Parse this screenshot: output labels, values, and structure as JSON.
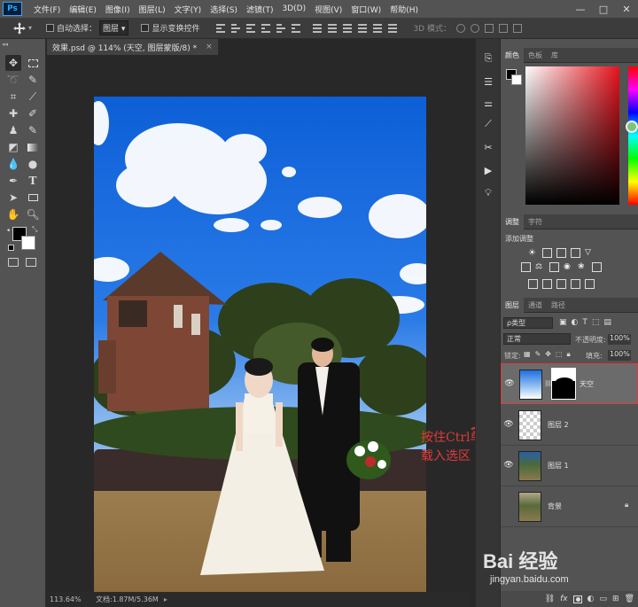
{
  "menubar": {
    "logo": "Ps",
    "items": [
      "文件(F)",
      "编辑(E)",
      "图像(I)",
      "图层(L)",
      "文字(Y)",
      "选择(S)",
      "滤镜(T)",
      "3D(D)",
      "视图(V)",
      "窗口(W)",
      "帮助(H)"
    ],
    "window_controls": [
      "—",
      "□",
      "✕"
    ]
  },
  "options": {
    "auto_select_label": "自动选择：",
    "auto_select_value": "图层",
    "show_transform_label": "显示变换控件",
    "mode_3d_label": "3D 模式："
  },
  "document": {
    "tab_title": "效果.psd @ 114% (天空, 图层蒙版/8) *",
    "tab_close": "×",
    "zoom": "113.64%",
    "doc_size": "文档:1.87M/5.36M"
  },
  "annotation": {
    "line1": "按住Ctrl单击",
    "line2": "载入选区"
  },
  "color_panel": {
    "tabs": [
      "颜色",
      "色板",
      "库"
    ],
    "foreground": "#000000",
    "background": "#ffffff"
  },
  "adjust_panel": {
    "tabs": [
      "调整",
      "字符"
    ],
    "title": "添加调整"
  },
  "layers_panel": {
    "tabs": [
      "图层",
      "通道",
      "路径"
    ],
    "filter_label": "ρ类型",
    "blend_mode": "正常",
    "opacity_label": "不透明度:",
    "opacity_value": "100%",
    "lock_label": "锁定:",
    "fill_label": "填充:",
    "fill_value": "100%",
    "layers": [
      {
        "name": "天空",
        "visible": true,
        "selected": true
      },
      {
        "name": "图层 2",
        "visible": true,
        "selected": false
      },
      {
        "name": "图层 1",
        "visible": true,
        "selected": false
      },
      {
        "name": "背景",
        "visible": false,
        "selected": false
      }
    ],
    "footer_icons": [
      "link-icon",
      "fx-icon",
      "add-mask-icon",
      "adjustment-icon",
      "folder-icon",
      "new-layer-icon",
      "trash-icon"
    ]
  },
  "watermark": {
    "brand": "Bai 经验",
    "url": "jingyan.baidu.com"
  },
  "colors": {
    "accent_red": "#e23a3a",
    "panel_bg": "#535353",
    "selected_layer": "#6b6b6b"
  }
}
